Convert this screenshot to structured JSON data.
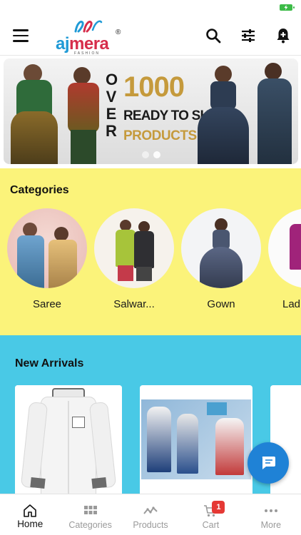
{
  "header": {
    "logo_text_a": "aj",
    "logo_text_m": "mera",
    "logo_registered": "®",
    "logo_tagline": "FASHION"
  },
  "banner": {
    "vertical_word": [
      "O",
      "V",
      "E",
      "R"
    ],
    "number": "1000",
    "line2": "READY TO SHIP",
    "line3": "PRODUCTS",
    "slides": 2,
    "active_slide": 1
  },
  "categories": {
    "title": "Categories",
    "items": [
      {
        "label": "Saree"
      },
      {
        "label": "Salwar..."
      },
      {
        "label": "Gown"
      },
      {
        "label": "Lad"
      }
    ]
  },
  "new_arrivals": {
    "title": "New Arrivals"
  },
  "bottom_nav": {
    "items": [
      {
        "label": "Home",
        "icon": "home-icon",
        "active": true
      },
      {
        "label": "Categories",
        "icon": "grid-icon",
        "active": false
      },
      {
        "label": "Products",
        "icon": "trend-icon",
        "active": false
      },
      {
        "label": "Cart",
        "icon": "cart-icon",
        "active": false,
        "badge": "1"
      },
      {
        "label": "More",
        "icon": "more-icon",
        "active": false
      }
    ]
  },
  "colors": {
    "categories_bg": "#fbf37a",
    "arrivals_bg": "#49c9e6",
    "accent_gold": "#c59a3c",
    "fab": "#1f82d6",
    "badge": "#e53935",
    "brand_blue": "#1f9ad6",
    "brand_red": "#d62d4b"
  }
}
